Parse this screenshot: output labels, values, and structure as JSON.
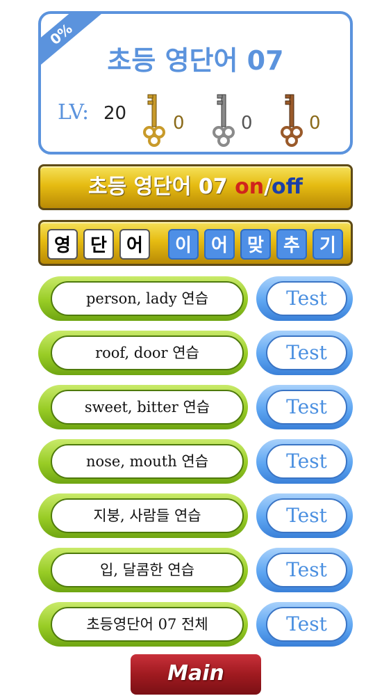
{
  "header": {
    "progress": "0%",
    "title": "초등 영단어 07",
    "level_label": "LV:",
    "level_value": "20",
    "keys": [
      {
        "icon": "gold-key-icon",
        "count": "0",
        "color": "#c89a2a"
      },
      {
        "icon": "silver-key-icon",
        "count": "0",
        "color": "#8a8a8a"
      },
      {
        "icon": "bronze-key-icon",
        "count": "0",
        "color": "#9a5a2a"
      }
    ]
  },
  "toggle": {
    "prefix": "초등 영단어 07 ",
    "on": "on",
    "slash": "/",
    "off": "off"
  },
  "modes": {
    "word_tiles": [
      "영",
      "단",
      "어"
    ],
    "match_tiles": [
      "이",
      "어",
      "맞",
      "추",
      "기"
    ]
  },
  "rows": [
    {
      "practice": "person, lady 연습",
      "test": "Test"
    },
    {
      "practice": "roof, door 연습",
      "test": "Test"
    },
    {
      "practice": "sweet, bitter 연습",
      "test": "Test"
    },
    {
      "practice": "nose, mouth 연습",
      "test": "Test"
    },
    {
      "practice": "지붕, 사람들 연습",
      "test": "Test"
    },
    {
      "practice": "입, 달콤한 연습",
      "test": "Test"
    },
    {
      "practice": "초등영단어 07 전체",
      "test": "Test"
    }
  ],
  "main_button": "Main",
  "colors": {
    "accent_blue": "#5b93dd",
    "gold": "#e6bc12",
    "green": "#98cc25",
    "red": "#a01a20"
  }
}
